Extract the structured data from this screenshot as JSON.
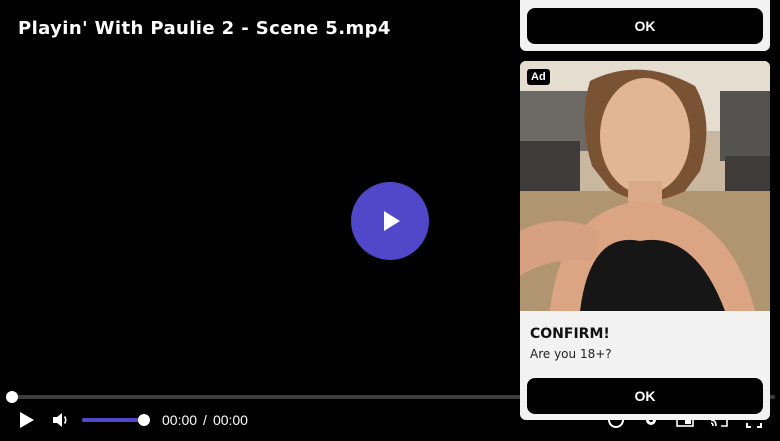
{
  "video": {
    "title": "Playin' With Paulie 2 - Scene 5.mp4",
    "progress": 0,
    "volume": 0.9
  },
  "controls": {
    "current_time": "00:00",
    "separator": "/",
    "duration": "00:00",
    "icons": [
      "play-icon",
      "volume-icon",
      "quality-icon",
      "settings-icon",
      "pip-icon",
      "cast-icon",
      "fullscreen-icon"
    ]
  },
  "ad_top": {
    "button_label": "OK"
  },
  "ad_card": {
    "badge": "Ad",
    "heading": "CONFIRM!",
    "subtext": "Are you 18+?",
    "button_label": "OK"
  },
  "colors": {
    "accent": "#5147c9",
    "ad_background": "#f2f2f2",
    "button": "#000000"
  }
}
